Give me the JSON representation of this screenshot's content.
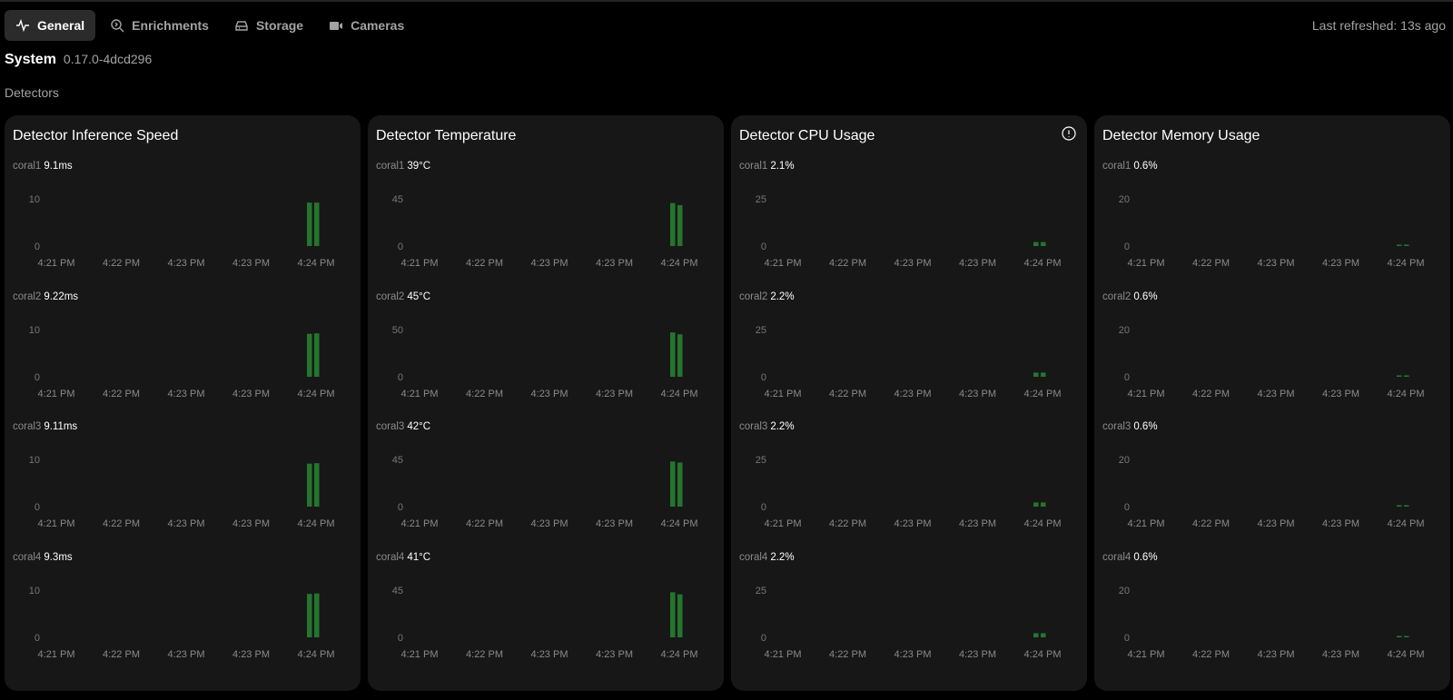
{
  "tabs": [
    {
      "label": "General",
      "icon": "activity-icon",
      "active": true
    },
    {
      "label": "Enrichments",
      "icon": "search-ai-icon"
    },
    {
      "label": "Storage",
      "icon": "hard-drive-icon"
    },
    {
      "label": "Cameras",
      "icon": "video-icon"
    }
  ],
  "last_refreshed": "Last refreshed: 13s ago",
  "system": {
    "title": "System",
    "version": "0.17.0-4dcd296"
  },
  "section": "Detectors",
  "colors": {
    "bar": "#24752e",
    "card": "#171717",
    "muted": "#8a8a8a"
  },
  "chart_data": [
    {
      "type": "bar",
      "title": "Detector Inference Speed",
      "info_icon": false,
      "x_ticks": [
        "4:21 PM",
        "4:22 PM",
        "4:23 PM",
        "4:23 PM",
        "4:24 PM"
      ],
      "series": [
        {
          "name": "coral1",
          "current": "9.1ms",
          "ylim": [
            0,
            10
          ],
          "yticks": [
            "10",
            "0"
          ],
          "values": [
            9.2,
            9.2
          ]
        },
        {
          "name": "coral2",
          "current": "9.22ms",
          "ylim": [
            0,
            10
          ],
          "yticks": [
            "10",
            "0"
          ],
          "values": [
            9.1,
            9.2
          ]
        },
        {
          "name": "coral3",
          "current": "9.11ms",
          "ylim": [
            0,
            10
          ],
          "yticks": [
            "10",
            "0"
          ],
          "values": [
            9.1,
            9.2
          ]
        },
        {
          "name": "coral4",
          "current": "9.3ms",
          "ylim": [
            0,
            10
          ],
          "yticks": [
            "10",
            "0"
          ],
          "values": [
            9.2,
            9.3
          ]
        }
      ]
    },
    {
      "type": "bar",
      "title": "Detector Temperature",
      "info_icon": false,
      "x_ticks": [
        "4:21 PM",
        "4:22 PM",
        "4:23 PM",
        "4:23 PM",
        "4:24 PM"
      ],
      "series": [
        {
          "name": "coral1",
          "current": "39°C",
          "ylim": [
            0,
            45
          ],
          "yticks": [
            "45",
            "0"
          ],
          "values": [
            41,
            39
          ]
        },
        {
          "name": "coral2",
          "current": "45°C",
          "ylim": [
            0,
            50
          ],
          "yticks": [
            "50",
            "0"
          ],
          "values": [
            47,
            45
          ]
        },
        {
          "name": "coral3",
          "current": "42°C",
          "ylim": [
            0,
            45
          ],
          "yticks": [
            "45",
            "0"
          ],
          "values": [
            43,
            42
          ]
        },
        {
          "name": "coral4",
          "current": "41°C",
          "ylim": [
            0,
            45
          ],
          "yticks": [
            "45",
            "0"
          ],
          "values": [
            43,
            41
          ]
        }
      ]
    },
    {
      "type": "bar",
      "title": "Detector CPU Usage",
      "info_icon": true,
      "x_ticks": [
        "4:21 PM",
        "4:22 PM",
        "4:23 PM",
        "4:23 PM",
        "4:24 PM"
      ],
      "series": [
        {
          "name": "coral1",
          "current": "2.1%",
          "ylim": [
            0,
            25
          ],
          "yticks": [
            "25",
            "0"
          ],
          "values": [
            2.1,
            2.1
          ]
        },
        {
          "name": "coral2",
          "current": "2.2%",
          "ylim": [
            0,
            25
          ],
          "yticks": [
            "25",
            "0"
          ],
          "values": [
            2.2,
            2.2
          ]
        },
        {
          "name": "coral3",
          "current": "2.2%",
          "ylim": [
            0,
            25
          ],
          "yticks": [
            "25",
            "0"
          ],
          "values": [
            2.2,
            2.2
          ]
        },
        {
          "name": "coral4",
          "current": "2.2%",
          "ylim": [
            0,
            25
          ],
          "yticks": [
            "25",
            "0"
          ],
          "values": [
            2.2,
            2.2
          ]
        }
      ]
    },
    {
      "type": "bar",
      "title": "Detector Memory Usage",
      "info_icon": false,
      "x_ticks": [
        "4:21 PM",
        "4:22 PM",
        "4:23 PM",
        "4:23 PM",
        "4:24 PM"
      ],
      "series": [
        {
          "name": "coral1",
          "current": "0.6%",
          "ylim": [
            0,
            20
          ],
          "yticks": [
            "20",
            "0"
          ],
          "values": [
            0.6,
            0.6
          ]
        },
        {
          "name": "coral2",
          "current": "0.6%",
          "ylim": [
            0,
            20
          ],
          "yticks": [
            "20",
            "0"
          ],
          "values": [
            0.6,
            0.6
          ]
        },
        {
          "name": "coral3",
          "current": "0.6%",
          "ylim": [
            0,
            20
          ],
          "yticks": [
            "20",
            "0"
          ],
          "values": [
            0.6,
            0.6
          ]
        },
        {
          "name": "coral4",
          "current": "0.6%",
          "ylim": [
            0,
            20
          ],
          "yticks": [
            "20",
            "0"
          ],
          "values": [
            0.6,
            0.6
          ]
        }
      ]
    }
  ]
}
